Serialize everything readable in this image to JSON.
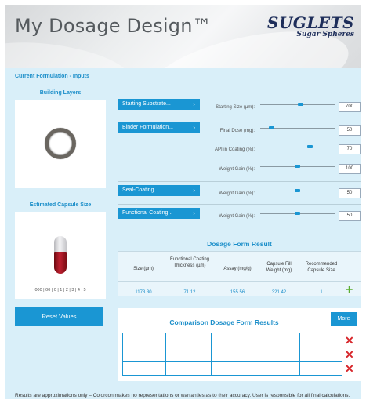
{
  "header": {
    "title": "My Dosage Design™",
    "brand_name": "SUGLETS",
    "brand_sub": "Sugar Spheres"
  },
  "section_label": "Current Formulation - Inputs",
  "building_layers": {
    "title": "Building Layers"
  },
  "capsule": {
    "title": "Estimated Capsule Size",
    "scale": "000 | 00 | 0 | 1 | 2 | 3 | 4 | 5"
  },
  "reset_label": "Reset Values",
  "inputs": {
    "starting_substrate": {
      "label": "Starting Substrate...",
      "chevron": "›"
    },
    "starting_size": {
      "label": "Starting Size (µm):",
      "value": "700",
      "level": 0.55
    },
    "binder": {
      "label": "Binder Formulation...",
      "chevron": "›"
    },
    "final_dose": {
      "label": "Final Dose (mg):",
      "value": "50",
      "level": 0.12
    },
    "api_coating": {
      "label": "API in Coating (%):",
      "value": "70",
      "level": 0.68
    },
    "weight_gain_binder": {
      "label": "Weight Gain (%):",
      "value": "100",
      "level": 0.5
    },
    "seal_coating": {
      "label": "Seal-Coating...",
      "chevron": "›"
    },
    "weight_gain_seal": {
      "label": "Weight Gain (%):",
      "value": "50",
      "level": 0.5
    },
    "functional_coating": {
      "label": "Functional Coating...",
      "chevron": "›"
    },
    "weight_gain_functional": {
      "label": "Weight Gain (%):",
      "value": "50",
      "level": 0.5
    }
  },
  "results": {
    "title": "Dosage Form Result",
    "headers": [
      "Size (µm)",
      "Functional Coating Thickness (µm)",
      "Assay (mg/g)",
      "Capsule Fill Weight (mg)",
      "Recommended Capsule Size"
    ],
    "values": [
      "1173.30",
      "71.12",
      "155.56",
      "321.42",
      "1"
    ],
    "add": "+"
  },
  "comparison": {
    "title": "Comparison Dosage Form Results",
    "more_label": "More",
    "remove": "✕"
  },
  "disclaimer": "Results are approximations only – Colorcon makes no representations or warranties as to their accuracy. User is responsible for all final calculations."
}
